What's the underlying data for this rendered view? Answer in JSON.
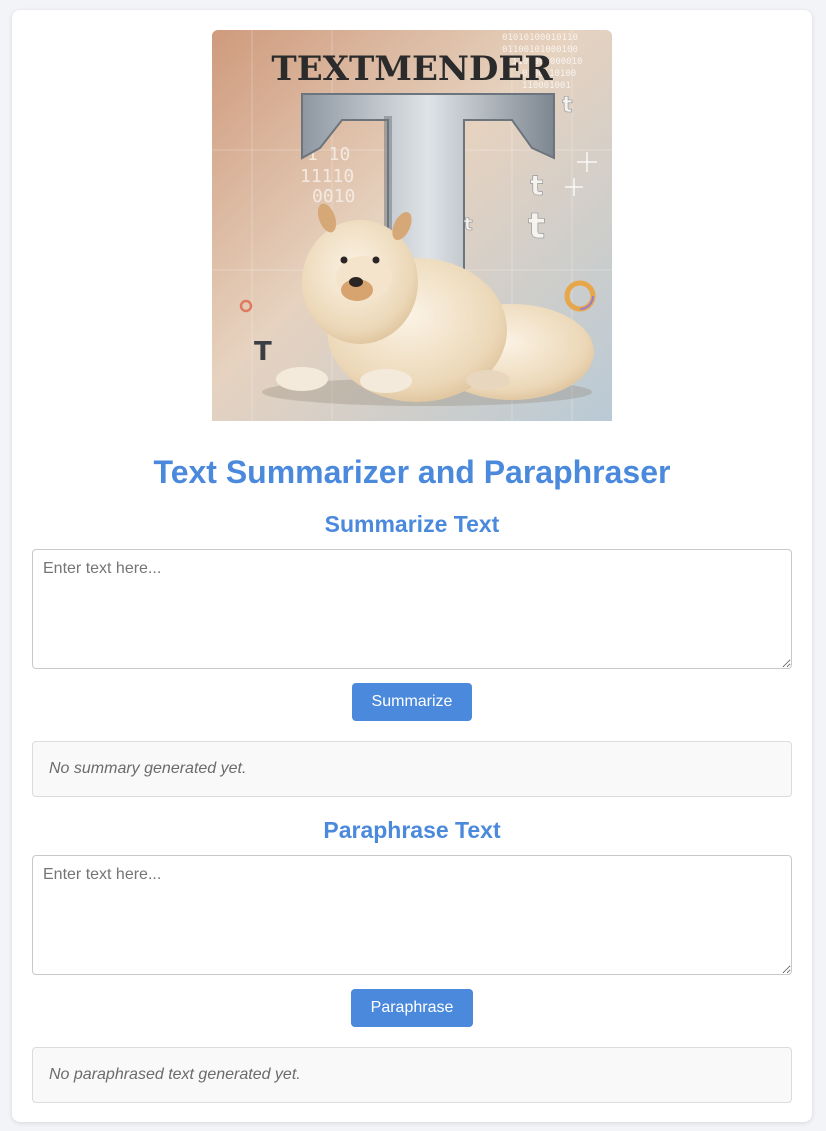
{
  "hero": {
    "logo_text": "TEXTMENDER",
    "alt": "TextMender chow chow illustration",
    "colors": {
      "warm": "#cf9a7c",
      "cool": "#b9cad6",
      "fur": "#efe1c8",
      "letter": "#9aa3ad"
    }
  },
  "page": {
    "title": "Text Summarizer and Paraphraser"
  },
  "summarize": {
    "heading": "Summarize Text",
    "placeholder": "Enter text here...",
    "button_label": "Summarize",
    "result": "No summary generated yet."
  },
  "paraphrase": {
    "heading": "Paraphrase Text",
    "placeholder": "Enter text here...",
    "button_label": "Paraphrase",
    "result": "No paraphrased text generated yet."
  },
  "colors": {
    "accent": "#4a89dc",
    "background": "#f3f4f8",
    "card": "#ffffff",
    "result_bg": "#f9f9f9"
  }
}
